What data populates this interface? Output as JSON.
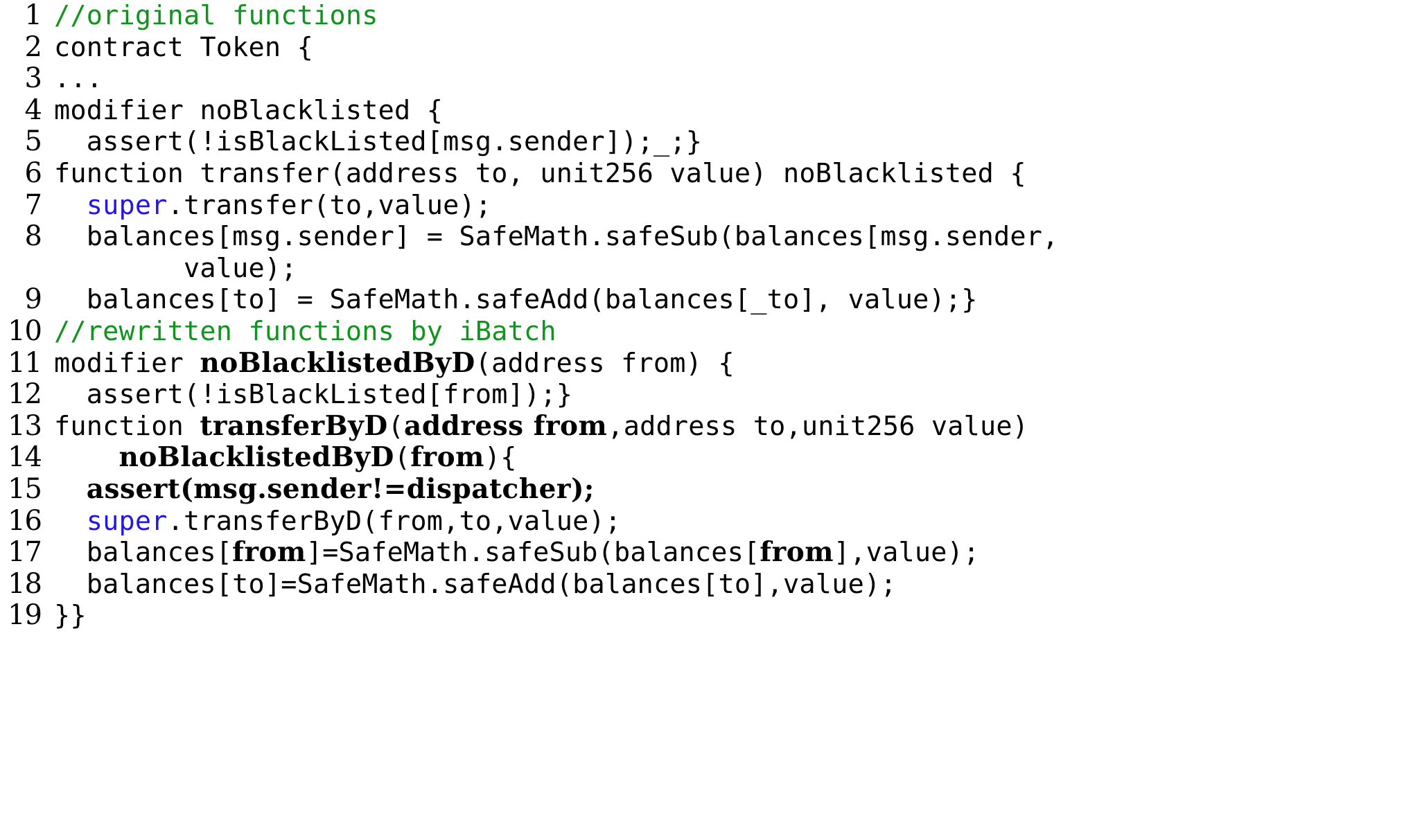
{
  "listing": {
    "language": "Solidity",
    "colors": {
      "comment": "#12931f",
      "keyword": "#2316e8",
      "text": "#000000",
      "background": "#ffffff"
    },
    "lines": [
      {
        "number": "1",
        "text": "//original functions"
      },
      {
        "number": "2",
        "text": "contract Token {"
      },
      {
        "number": "3",
        "text": "..."
      },
      {
        "number": "4",
        "text": "modifier noBlacklisted {"
      },
      {
        "number": "5",
        "text": "  assert(!isBlackListed[msg.sender]);_;}"
      },
      {
        "number": "6",
        "text": "function transfer(address to, unit256 value) noBlacklisted {"
      },
      {
        "number": "7",
        "text": "  super.transfer(to,value);"
      },
      {
        "number": "8",
        "text": "  balances[msg.sender] = SafeMath.safeSub(balances[msg.sender,"
      },
      {
        "number": "",
        "text": "        value);"
      },
      {
        "number": "9",
        "text": "  balances[to] = SafeMath.safeAdd(balances[_to], value);}"
      },
      {
        "number": "10",
        "text": "//rewritten functions by iBatch"
      },
      {
        "number": "11",
        "text": "modifier noBlacklistedByD(address from) {"
      },
      {
        "number": "12",
        "text": "  assert(!isBlackListed[from]);}"
      },
      {
        "number": "13",
        "text": "function transferByD(address from,address to,unit256 value)"
      },
      {
        "number": "14",
        "text": "    noBlacklistedByD(from){"
      },
      {
        "number": "15",
        "text": "  assert(msg.sender!=dispatcher);"
      },
      {
        "number": "16",
        "text": "  super.transferByD(from,to,value);"
      },
      {
        "number": "17",
        "text": "  balances[from]=SafeMath.safeSub(balances[from],value);"
      },
      {
        "number": "18",
        "text": "  balances[to]=SafeMath.safeAdd(balances[to],value);"
      },
      {
        "number": "19",
        "text": "}}"
      }
    ],
    "segments": {
      "l1": [
        {
          "t": "//original functions",
          "s": "cmt"
        }
      ],
      "l2": [
        {
          "t": "contract Token {",
          "s": ""
        }
      ],
      "l3": [
        {
          "t": "...",
          "s": ""
        }
      ],
      "l4": [
        {
          "t": "modifier noBlacklisted {",
          "s": ""
        }
      ],
      "l5a": [
        {
          "t": "  assert(!isBlackListed[msg.sender]);_;}",
          "s": ""
        }
      ],
      "l6": [
        {
          "t": "function transfer(address to, unit256 value) noBlacklisted {",
          "s": ""
        }
      ],
      "l7a": [
        {
          "t": "  ",
          "s": ""
        },
        {
          "t": "super",
          "s": "kw"
        },
        {
          "t": ".transfer(to,value);",
          "s": ""
        }
      ],
      "l8a": [
        {
          "t": "  balances[msg.sender] = SafeMath.safeSub(balances[msg.sender,",
          "s": ""
        }
      ],
      "l8b": [
        {
          "t": "        value);",
          "s": ""
        }
      ],
      "l9": [
        {
          "t": "  balances[to] = SafeMath.safeAdd(balances[_to], value);}",
          "s": ""
        }
      ],
      "l10": [
        {
          "t": "//rewritten functions by iBatch",
          "s": "cmt"
        }
      ],
      "l11": [
        {
          "t": "modifier ",
          "s": ""
        },
        {
          "t": "noBlacklistedByD",
          "s": "bold"
        },
        {
          "t": "(address from) {",
          "s": ""
        }
      ],
      "l12": [
        {
          "t": "  assert(!isBlackListed[from]);}",
          "s": ""
        }
      ],
      "l13": [
        {
          "t": "function ",
          "s": ""
        },
        {
          "t": "transferByD",
          "s": "bold"
        },
        {
          "t": "(",
          "s": ""
        },
        {
          "t": "address from",
          "s": "bold"
        },
        {
          "t": ",address to,unit256 value)",
          "s": ""
        }
      ],
      "l14": [
        {
          "t": "    ",
          "s": ""
        },
        {
          "t": "noBlacklistedByD",
          "s": "bold"
        },
        {
          "t": "(",
          "s": ""
        },
        {
          "t": "from",
          "s": "bold"
        },
        {
          "t": "){",
          "s": ""
        }
      ],
      "l15": [
        {
          "t": "  ",
          "s": ""
        },
        {
          "t": "assert(msg.sender!=dispatcher);",
          "s": "bold"
        }
      ],
      "l16": [
        {
          "t": "  ",
          "s": ""
        },
        {
          "t": "super",
          "s": "kw"
        },
        {
          "t": ".transferByD(from,to,value);",
          "s": ""
        }
      ],
      "l17": [
        {
          "t": "  balances[",
          "s": ""
        },
        {
          "t": "from",
          "s": "bold"
        },
        {
          "t": "]=SafeMath.safeSub(balances[",
          "s": ""
        },
        {
          "t": "from",
          "s": "bold"
        },
        {
          "t": "],value);",
          "s": ""
        }
      ],
      "l18": [
        {
          "t": "  balances[to]=SafeMath.safeAdd(balances[to],value);",
          "s": ""
        }
      ],
      "l19": [
        {
          "t": "}}",
          "s": ""
        }
      ]
    },
    "line_numbers": {
      "n1": "1",
      "n2": "2",
      "n3": "3",
      "n4": "4",
      "n5": "5",
      "n6": "6",
      "n7": "7",
      "n8": "8",
      "n8b": "",
      "n9": "9",
      "n10": "10",
      "n11": "11",
      "n12": "12",
      "n13": "13",
      "n14": "14",
      "n15": "15",
      "n16": "16",
      "n17": "17",
      "n18": "18",
      "n19": "19"
    }
  }
}
